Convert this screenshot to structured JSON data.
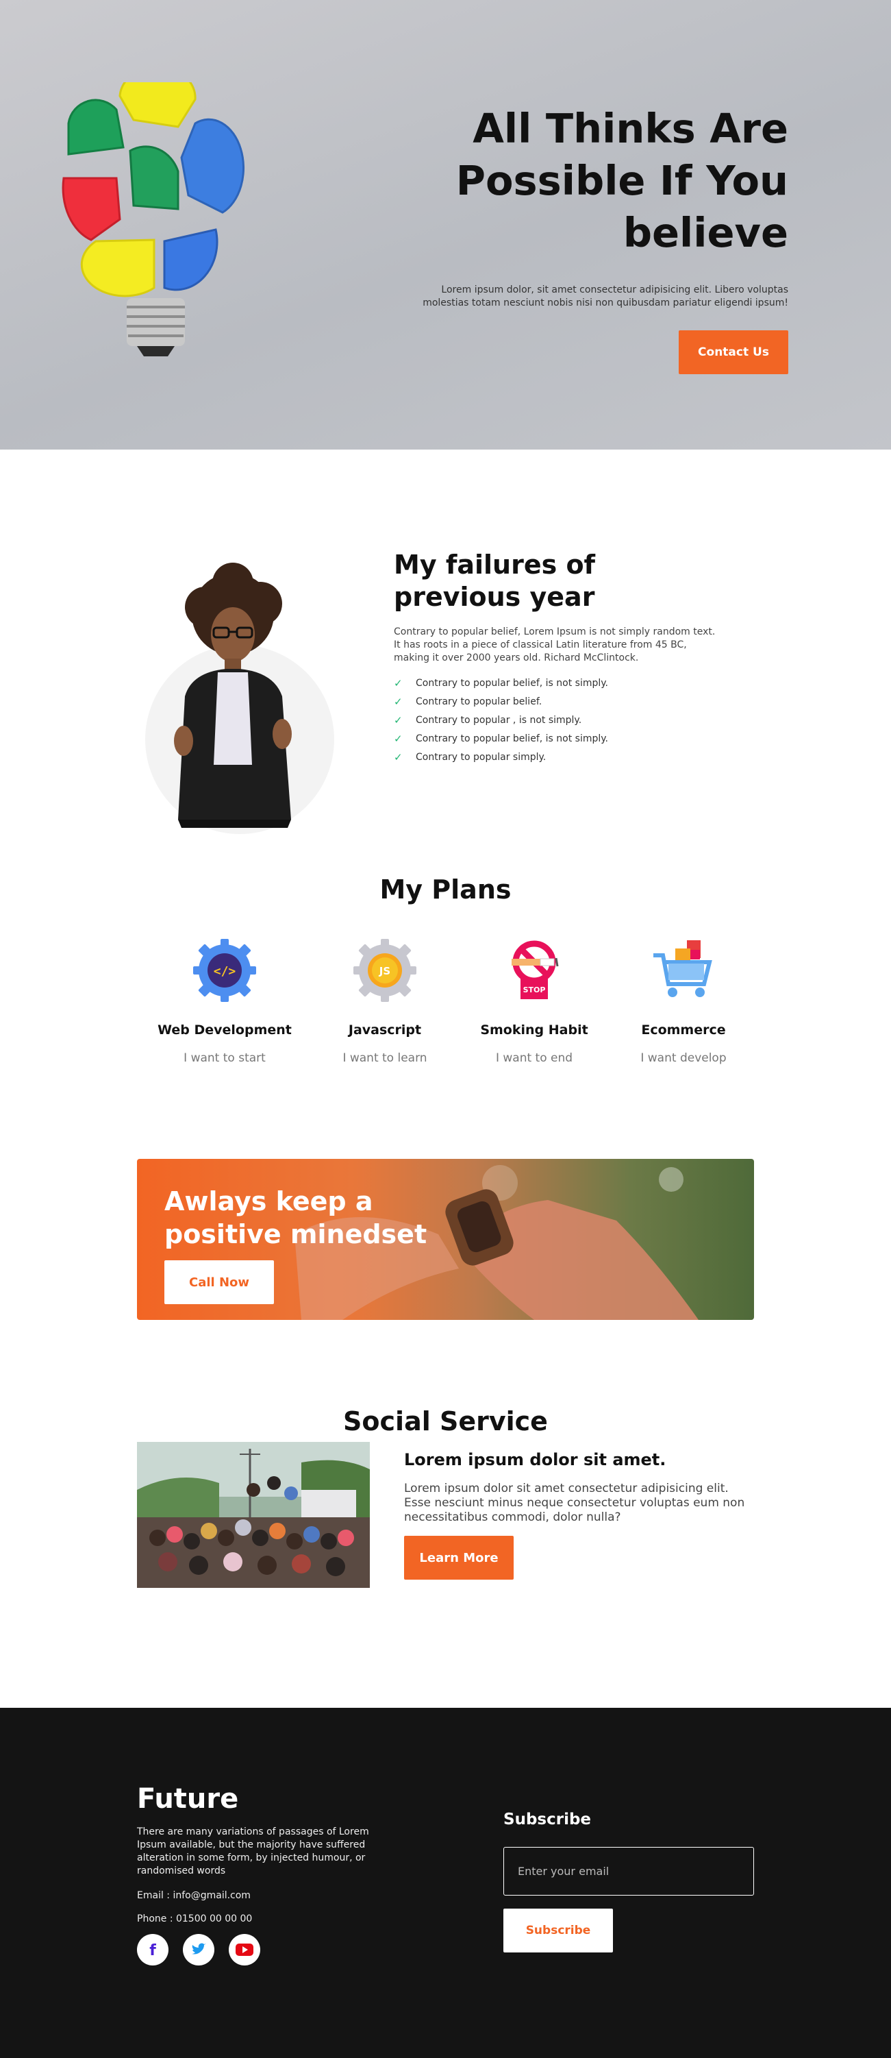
{
  "hero": {
    "title": "All Thinks Are Possible If You believe",
    "description": "Lorem ipsum dolor, sit amet consectetur adipisicing elit. Libero voluptas molestias totam nesciunt nobis nisi non quibusdam pariatur eligendi ipsum!",
    "button": "Contact Us"
  },
  "failures": {
    "title": "My failures of previous year",
    "description": "Contrary to popular belief, Lorem Ipsum is not simply random text. It has roots in a piece of classical Latin literature from 45 BC, making it over 2000 years old. Richard McClintock.",
    "items": [
      "Contrary to popular belief, is not simply.",
      "Contrary to popular belief.",
      "Contrary to popular , is not simply.",
      "Contrary to popular belief, is not simply.",
      "Contrary to popular simply."
    ]
  },
  "plans": {
    "title": "My Plans",
    "items": [
      {
        "name": "Web Development",
        "sub": "I want to start",
        "icon": "code-gear-icon"
      },
      {
        "name": "Javascript",
        "sub": "I want to learn",
        "icon": "js-gear-icon"
      },
      {
        "name": "Smoking Habit",
        "sub": "I want to end",
        "icon": "no-smoking-icon"
      },
      {
        "name": "Ecommerce",
        "sub": "I want develop",
        "icon": "shopping-cart-icon"
      }
    ],
    "stop_label": "STOP",
    "js_label": "JS"
  },
  "cta": {
    "title": "Awlays keep a positive minedset",
    "button": "Call Now"
  },
  "social": {
    "title": "Social Service",
    "heading": "Lorem ipsum dolor sit amet.",
    "description": "Lorem ipsum dolor sit amet consectetur adipisicing elit. Esse nesciunt minus neque consectetur voluptas eum non necessitatibus commodi, dolor nulla?",
    "button": "Learn More"
  },
  "footer": {
    "brand": "Future",
    "description": "There are many variations of passages of Lorem Ipsum available, but the majority have suffered alteration in some form, by injected humour, or randomised words",
    "email": "Email : info@gmail.com",
    "phone": "Phone : 01500 00 00 00",
    "socials": [
      "facebook-icon",
      "twitter-icon",
      "youtube-icon"
    ],
    "subscribe_title": "Subscribe",
    "email_placeholder": "Enter your email",
    "subscribe_button": "Subscribe"
  },
  "colors": {
    "accent": "#f26524",
    "footer_bg": "#141414",
    "check": "#22b573"
  }
}
